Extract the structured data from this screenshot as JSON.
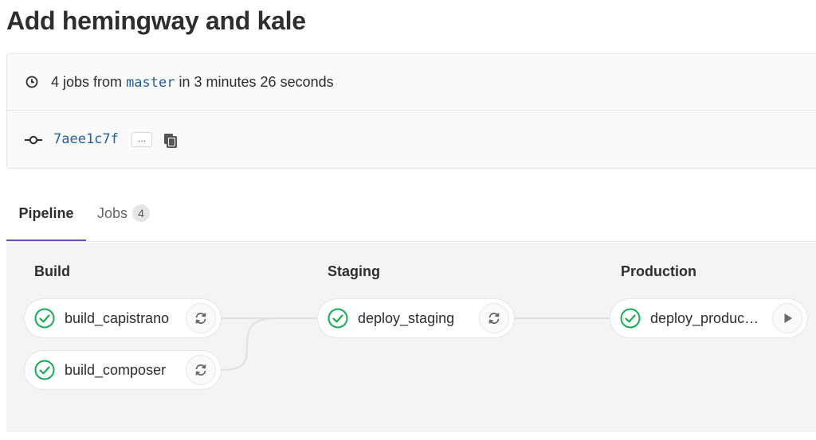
{
  "header": {
    "title": "Add hemingway and kale"
  },
  "info": {
    "jobs_count_text": "4 jobs from",
    "branch": "master",
    "duration_text": "in 3 minutes 26 seconds",
    "commit_sha": "7aee1c7f",
    "ellipsis": "..."
  },
  "tabs": {
    "pipeline_label": "Pipeline",
    "jobs_label": "Jobs",
    "jobs_count": "4"
  },
  "stages": [
    {
      "title": "Build",
      "jobs": [
        {
          "name": "build_capistrano",
          "status": "success",
          "action": "retry"
        },
        {
          "name": "build_composer",
          "status": "success",
          "action": "retry"
        }
      ]
    },
    {
      "title": "Staging",
      "jobs": [
        {
          "name": "deploy_staging",
          "status": "success",
          "action": "retry"
        }
      ]
    },
    {
      "title": "Production",
      "jobs": [
        {
          "name": "deploy_produc…",
          "status": "success",
          "action": "play"
        }
      ]
    }
  ],
  "colors": {
    "success": "#1aaa55",
    "link": "#1f5fa5",
    "tab_active": "#6b4fbb"
  }
}
